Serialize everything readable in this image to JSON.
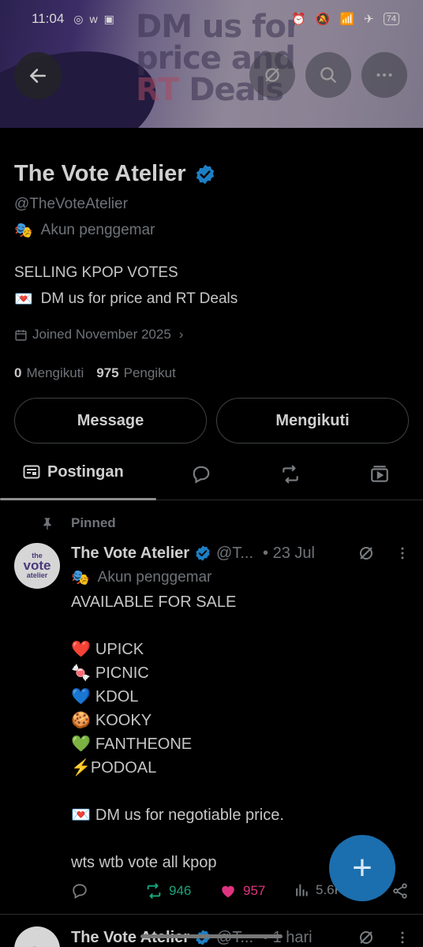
{
  "status_bar": {
    "time": "11:04",
    "battery": "74"
  },
  "banner": {
    "promo_line1": "DM us for",
    "promo_line2": "price and",
    "promo_line3_red": "RT",
    "promo_line3": "Deals"
  },
  "profile": {
    "name": "The Vote Atelier",
    "handle": "@TheVoteAtelier",
    "category": "Akun penggemar",
    "bio_line1": "SELLING KPOP VOTES",
    "bio_line2": "DM us for price and RT Deals",
    "joined": "Joined November 2025",
    "following_count": "0",
    "following_label": "Mengikuti",
    "followers_count": "975",
    "followers_label": "Pengikut"
  },
  "buttons": {
    "message": "Message",
    "following": "Mengikuti"
  },
  "tabs": {
    "active": "Postingan"
  },
  "pinned_post": {
    "pinned_label": "Pinned",
    "author": "The Vote Atelier",
    "handle": "@T...",
    "date": "• 23 Jul",
    "category": "Akun penggemar",
    "avatar_text": {
      "line1": "the",
      "line2": "vote",
      "line3": "atelier"
    },
    "body": {
      "headline": "AVAILABLE FOR SALE",
      "items": [
        {
          "emoji": "❤️",
          "text": "UPICK"
        },
        {
          "emoji": "🍬",
          "text": "PICNIC"
        },
        {
          "emoji": "💙",
          "text": "KDOL"
        },
        {
          "emoji": "🍪",
          "text": "KOOKY"
        },
        {
          "emoji": "💚",
          "text": "FANTHEONE"
        },
        {
          "emoji": "⚡",
          "text": "PODOAL"
        }
      ],
      "dm_line": "DM us for negotiable price.",
      "tags_line": "wts wtb vote all kpop"
    },
    "retweets": "946",
    "likes": "957",
    "views": "5.6K"
  },
  "next_post": {
    "author": "The Vote Atelier",
    "handle": "@T...",
    "date": "• 1 hari"
  },
  "colors": {
    "verified": "#1d7fc4",
    "retweet": "#19a27a",
    "like": "#e0337f",
    "fab": "#1b6fae"
  }
}
